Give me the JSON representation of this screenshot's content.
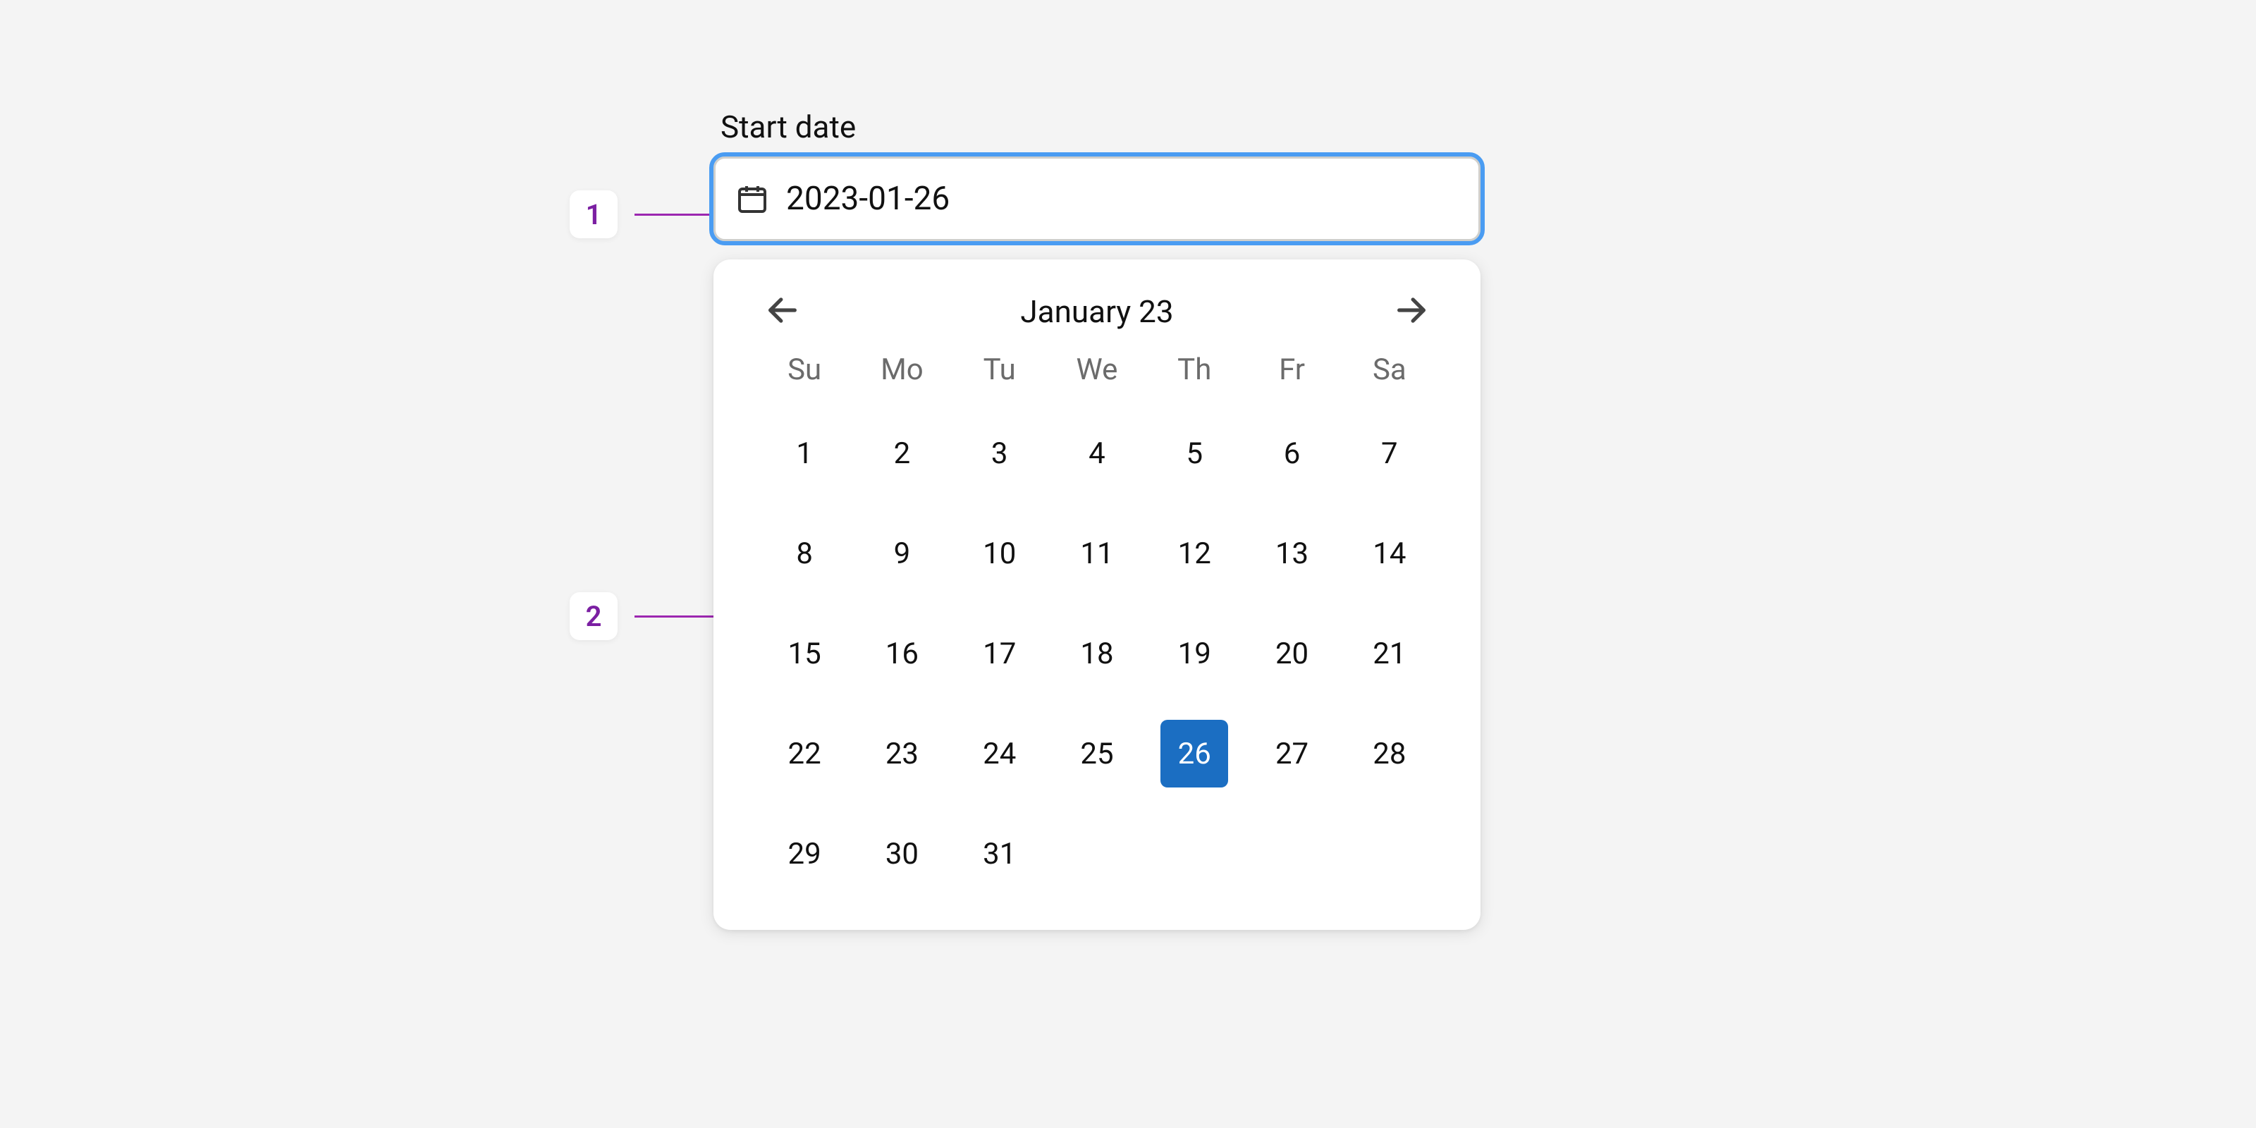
{
  "annotations": {
    "n1": "1",
    "n2": "2"
  },
  "field": {
    "label": "Start date",
    "value": "2023-01-26"
  },
  "calendar": {
    "month_label": "January 23",
    "selected_day": "26",
    "weekdays": [
      "Su",
      "Mo",
      "Tu",
      "We",
      "Th",
      "Fr",
      "Sa"
    ],
    "days": [
      "1",
      "2",
      "3",
      "4",
      "5",
      "6",
      "7",
      "8",
      "9",
      "10",
      "11",
      "12",
      "13",
      "14",
      "15",
      "16",
      "17",
      "18",
      "19",
      "20",
      "21",
      "22",
      "23",
      "24",
      "25",
      "26",
      "27",
      "28",
      "29",
      "30",
      "31"
    ]
  }
}
